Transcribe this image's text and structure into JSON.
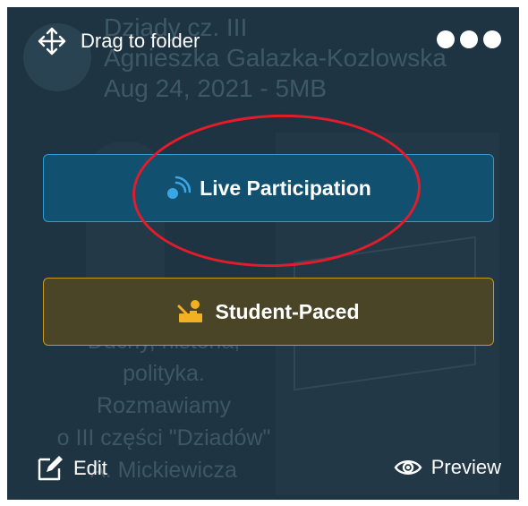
{
  "card": {
    "title": "Dziady cz. III",
    "author": "Agnieszka Galazka-Kozlowska",
    "date_size": "Aug 24, 2021 - 5MB",
    "description": [
      "Duchy, historia,",
      "polityka.",
      "Rozmawiamy",
      "o III części \"Dziadów\"",
      "A. Mickiewicza"
    ]
  },
  "toolbar": {
    "drag_label": "Drag to folder",
    "more_icon": "more-dots-icon"
  },
  "actions": {
    "live_label": "Live Participation",
    "live_icon": "live-broadcast-icon",
    "student_label": "Student-Paced",
    "student_icon": "student-desk-icon"
  },
  "footer": {
    "edit_label": "Edit",
    "preview_label": "Preview"
  },
  "colors": {
    "card_bg": "#1e3442",
    "live_accent": "#2e9bd6",
    "student_accent": "#c8981f",
    "annotation": "#e21c2a"
  }
}
